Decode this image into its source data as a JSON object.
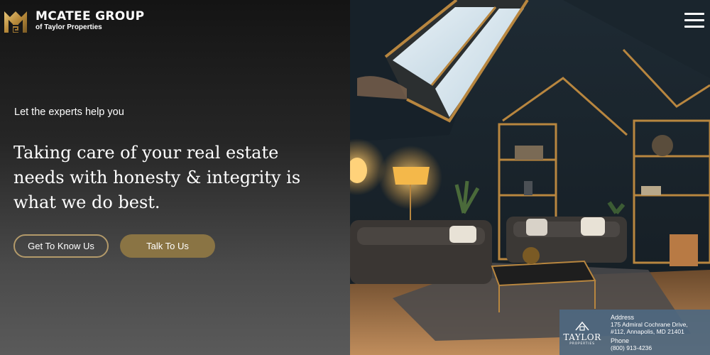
{
  "brand": {
    "title": "MCATEE GROUP",
    "subtitle": "of Taylor Properties",
    "logo_icon": "mg-monogram-icon",
    "accent_color": "#b39a6a"
  },
  "hero": {
    "eyebrow": "Let the experts help you",
    "headline": "Taking care of your real estate needs with honesty & integrity is what we do best.",
    "buttons": {
      "primary_label": "Get To Know Us",
      "secondary_label": "Talk To Us"
    }
  },
  "nav": {
    "menu_icon": "hamburger-menu-icon"
  },
  "contact": {
    "logo_text": "TAYLOR",
    "logo_subtext": "PROPERTIES",
    "address_label": "Address",
    "address_line1": "175 Admiral Cochrane Drive,",
    "address_line2": "#112, Annapolis, MD 21401",
    "phone_label": "Phone",
    "phone": "(800) 913-4236"
  }
}
